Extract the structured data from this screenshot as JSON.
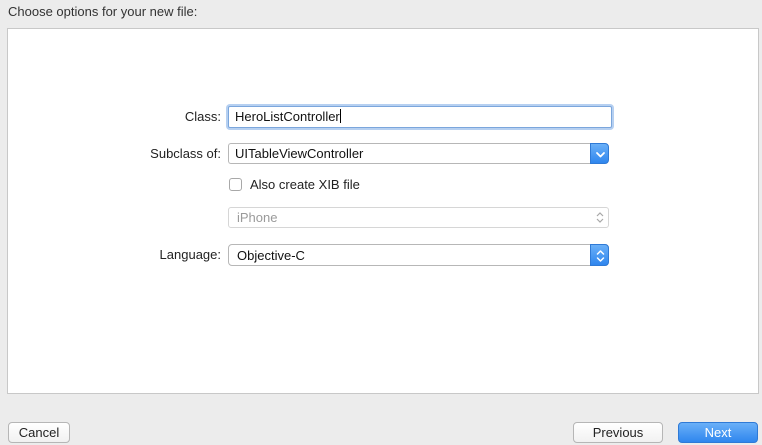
{
  "header": {
    "title": "Choose options for your new file:"
  },
  "form": {
    "class_label": "Class:",
    "class_value": "HeroListController",
    "subclass_label": "Subclass of:",
    "subclass_value": "UITableViewController",
    "xib_checkbox_label": "Also create XIB file",
    "xib_checked": false,
    "device_value": "iPhone",
    "language_label": "Language:",
    "language_value": "Objective-C"
  },
  "footer": {
    "cancel_label": "Cancel",
    "previous_label": "Previous",
    "next_label": "Next"
  },
  "colors": {
    "accent": "#2f86ee",
    "focus_ring": "#b6d0f1"
  },
  "icons": {
    "subclass_dropdown": "chevron-down-icon",
    "device_popup": "up-down-chevron-icon",
    "language_popup": "up-down-chevron-icon"
  }
}
